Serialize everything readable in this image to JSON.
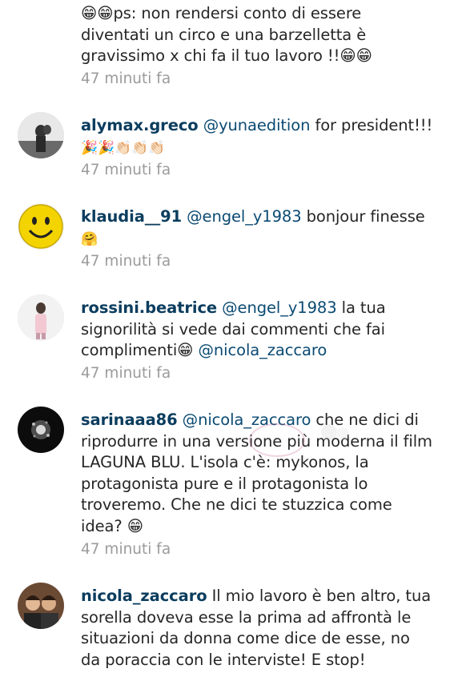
{
  "comments": [
    {
      "text": "😁😁ps: non rendersi conto di essere diventati un circo e una barzelletta è gravissimo x chi fa il tuo lavoro !!😁😁",
      "time": "47 minuti fa"
    },
    {
      "username": "alymax.greco",
      "mention": "@yunaedition",
      "text": " for president!!!",
      "line2": "🎉🎉👏🏻👏🏻👏🏻",
      "time": "47 minuti fa"
    },
    {
      "username": "klaudia__91",
      "mention": "@engel_y1983",
      "text": " bonjour finesse",
      "line2": "🤗",
      "time": "47 minuti fa"
    },
    {
      "username": "rossini.beatrice",
      "mention": "@engel_y1983",
      "text": " la tua signorilità si vede dai commenti che fai complimenti😁 ",
      "mention2": "@nicola_zaccaro",
      "time": "47 minuti fa"
    },
    {
      "username": "sarinaaa86",
      "mention": "@nicola_zaccaro",
      "text": " che ne dici di riprodurre in una versione più moderna  il film LAGUNA BLU. L'isola c'è: mykonos, la protagonista pure e il protagonista lo troveremo. Che ne dici te stuzzica come idea? 😁",
      "time": "47 minuti fa"
    },
    {
      "username": "nicola_zaccaro",
      "text": " Il mio lavoro è ben altro, tua sorella doveva esse la prima ad affrontà le situazioni da donna come dice de esse, no da poraccia con le interviste! E stop!"
    }
  ]
}
